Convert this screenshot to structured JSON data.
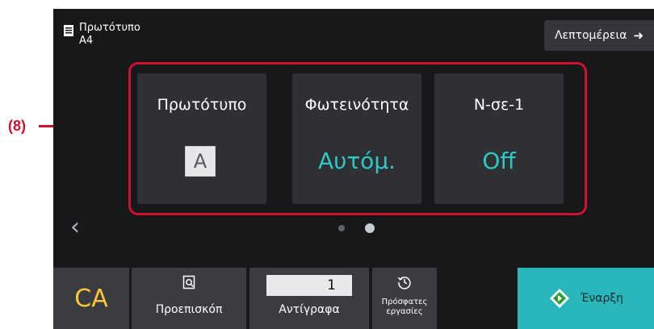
{
  "callout": {
    "label": "(8)"
  },
  "header": {
    "original_name": "Πρωτότυπο",
    "original_size": "A4",
    "details_label": "Λεπτομέρεια",
    "details_icon": "arrow-right-icon"
  },
  "tiles": [
    {
      "label": "Πρωτότυπο",
      "value": "A"
    },
    {
      "label": "Φωτεινότητα",
      "value": "Αυτόμ."
    },
    {
      "label": "N-σε-1",
      "value": "Off"
    }
  ],
  "pager": {
    "pages": 2,
    "current": 2
  },
  "bottom": {
    "ca_label": "CA",
    "preview_label": "Προεπισκόπ",
    "copies_value": "1",
    "copies_label": "Αντίγραφα",
    "recent_label_line1": "Πρόσφατες",
    "recent_label_line2": "εργασίες",
    "start_label": "Έναρξη"
  },
  "colors": {
    "accent_teal": "#2fc7c8",
    "start_button": "#29b6ba",
    "ca_yellow": "#ffc53a",
    "callout_red": "#d0102e",
    "screen_bg": "#17181a",
    "tile_bg": "#2e3033"
  }
}
